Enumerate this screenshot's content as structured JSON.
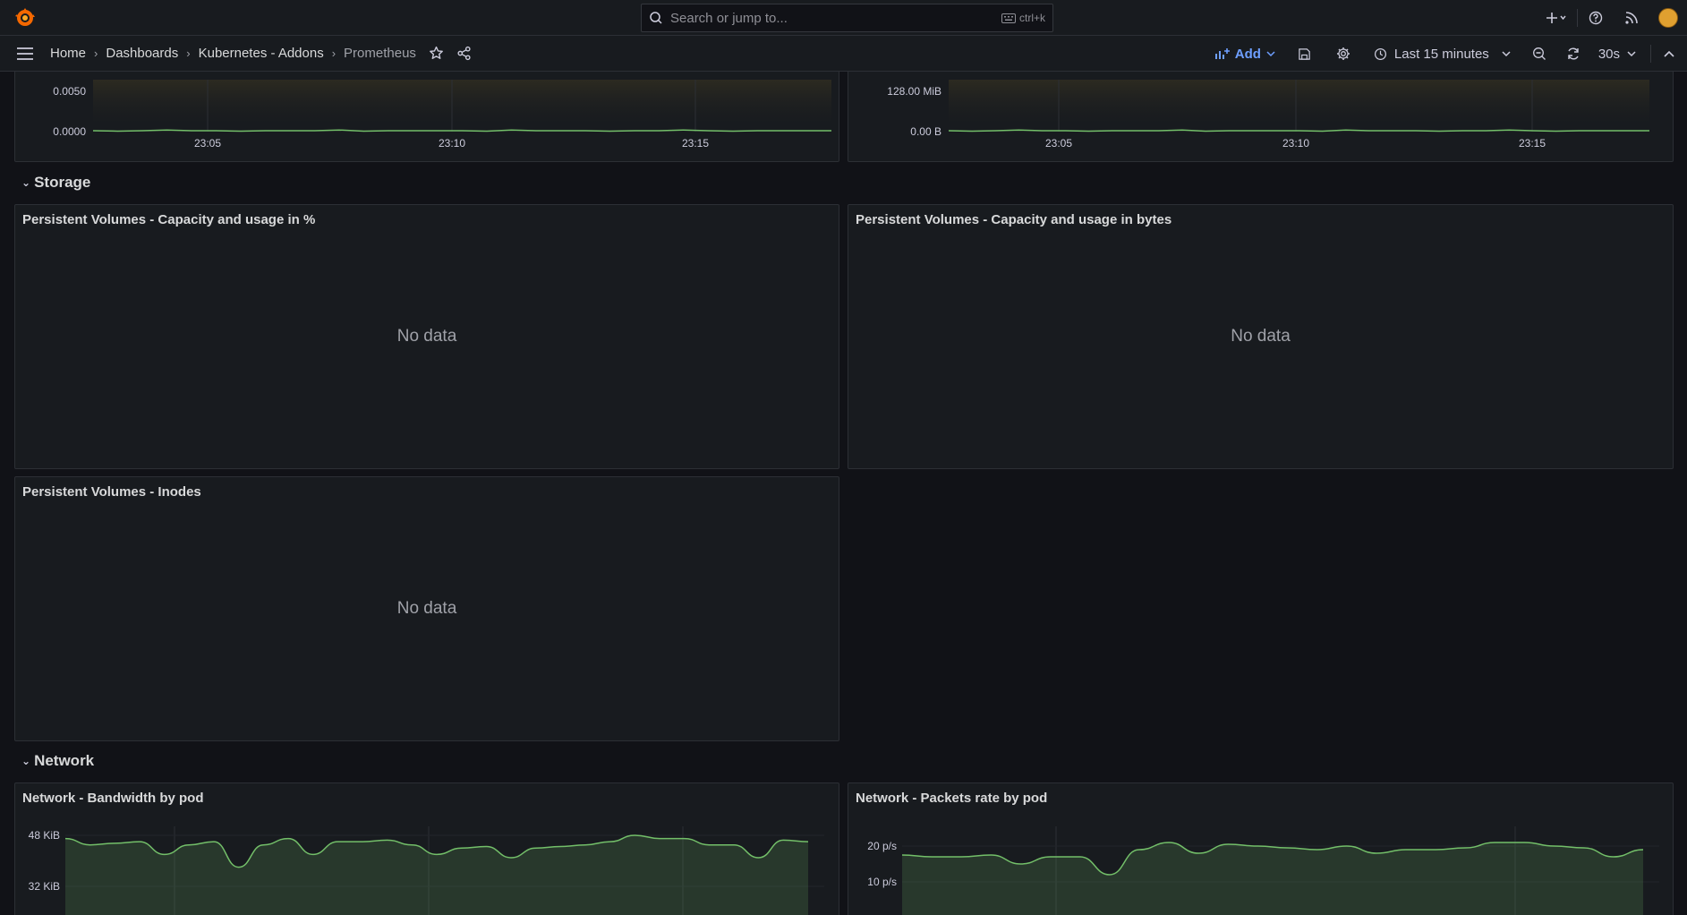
{
  "topbar": {
    "search_placeholder": "Search or jump to...",
    "search_shortcut": "ctrl+k",
    "icons": [
      "grafana-logo-icon",
      "plus-icon",
      "chevron-down-icon",
      "help-icon",
      "rss-icon",
      "avatar"
    ]
  },
  "breadcrumb": {
    "items": [
      "Home",
      "Dashboards",
      "Kubernetes - Addons",
      "Prometheus"
    ]
  },
  "toolbar": {
    "add_label": "Add",
    "time_range": "Last 15 minutes",
    "refresh_interval": "30s"
  },
  "colors": {
    "background": "#111217",
    "panel": "#181b1f",
    "series": "#73bf69",
    "accent": "#6e9fff"
  },
  "panels_top": [
    {
      "y_ticks": [
        "0.0050",
        "0.0000"
      ],
      "x_ticks": [
        "23:05",
        "23:10",
        "23:15"
      ]
    },
    {
      "y_ticks": [
        "128.00 MiB",
        "0.00 B"
      ],
      "x_ticks": [
        "23:05",
        "23:10",
        "23:15"
      ]
    }
  ],
  "rows": {
    "storage": "Storage",
    "network": "Network"
  },
  "storage_panels": [
    {
      "title": "Persistent Volumes - Capacity and usage in %",
      "status": "No data"
    },
    {
      "title": "Persistent Volumes - Capacity and usage in bytes",
      "status": "No data"
    },
    {
      "title": "Persistent Volumes - Inodes",
      "status": "No data"
    }
  ],
  "network_panels": [
    {
      "title": "Network - Bandwidth by pod",
      "y_ticks": [
        "48 KiB",
        "32 KiB"
      ]
    },
    {
      "title": "Network - Packets rate by pod",
      "y_ticks": [
        "20 p/s",
        "10 p/s"
      ]
    }
  ],
  "chart_data": [
    {
      "type": "line",
      "x": [
        "23:05",
        "23:10",
        "23:15"
      ],
      "yticks": [
        "0.0050",
        "0.0000"
      ],
      "series": [
        {
          "values": [
            0,
            0,
            0
          ]
        }
      ]
    },
    {
      "type": "line",
      "x": [
        "23:05",
        "23:10",
        "23:15"
      ],
      "yticks": [
        "128.00 MiB",
        "0.00 B"
      ],
      "series": [
        {
          "values": [
            0,
            0,
            0
          ]
        }
      ]
    },
    {
      "type": "area",
      "title": "Network - Bandwidth by pod",
      "yticks": [
        "48 KiB",
        "32 KiB"
      ],
      "series": [
        {
          "values": [
            47,
            45,
            45.5,
            46,
            42,
            45,
            46,
            38,
            45,
            47,
            42,
            46,
            46,
            46.5,
            45,
            42,
            44,
            44.5,
            41,
            44,
            44.5,
            45,
            46,
            48,
            47,
            47,
            45,
            45,
            41,
            46.5,
            46
          ]
        }
      ]
    },
    {
      "type": "area",
      "title": "Network - Packets rate by pod",
      "yticks": [
        "20 p/s",
        "10 p/s"
      ],
      "series": [
        {
          "values": [
            17.5,
            17,
            17,
            17.5,
            15,
            17,
            17,
            12,
            19,
            21,
            18,
            20.5,
            20,
            19.5,
            19,
            20,
            18,
            19,
            19,
            19.5,
            21,
            21,
            20,
            19.5,
            17,
            19
          ]
        }
      ]
    }
  ]
}
